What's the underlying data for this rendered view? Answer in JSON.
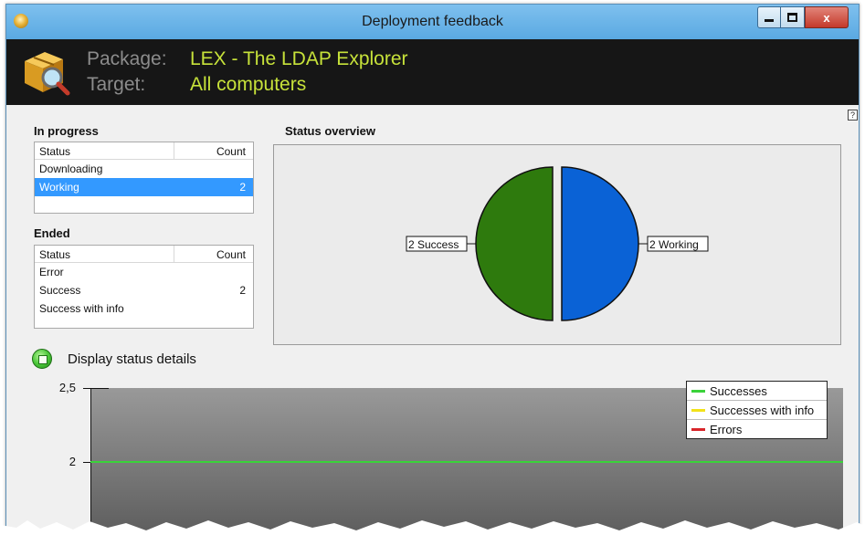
{
  "window": {
    "title": "Deployment feedback",
    "controls": {
      "minimize": "minimize",
      "maximize": "maximize",
      "close": "x"
    }
  },
  "header": {
    "package_label": "Package:",
    "package_value": "LEX - The LDAP Explorer",
    "target_label": "Target:",
    "target_value": "All computers"
  },
  "help_icon_label": "?",
  "in_progress": {
    "title": "In progress",
    "columns": [
      "Status",
      "Count"
    ],
    "rows": [
      {
        "status": "Downloading",
        "count": ""
      },
      {
        "status": "Working",
        "count": "2",
        "selected": true
      }
    ]
  },
  "ended": {
    "title": "Ended",
    "columns": [
      "Status",
      "Count"
    ],
    "rows": [
      {
        "status": "Error",
        "count": ""
      },
      {
        "status": "Success",
        "count": "2"
      },
      {
        "status": "Success with info",
        "count": ""
      }
    ]
  },
  "status_overview": {
    "title": "Status overview"
  },
  "status_details": {
    "label": "Display status details"
  },
  "chart_data": [
    {
      "type": "pie",
      "categories": [
        "Working",
        "Success"
      ],
      "values": [
        2,
        2
      ],
      "slice_labels": [
        "2 Working",
        "2 Success"
      ],
      "colors": [
        "#0a62d6",
        "#2e7a0d"
      ]
    },
    {
      "type": "line",
      "yticks": [
        "2,5",
        "2"
      ],
      "ytick_values": [
        2.5,
        2
      ],
      "ylim_top": 2.5,
      "series": [
        {
          "name": "Successes",
          "color": "#3ad23a",
          "value": 2
        },
        {
          "name": "Successes with info",
          "color": "#f2e21a"
        },
        {
          "name": "Errors",
          "color": "#d8252a"
        }
      ],
      "legend_position": "top-right"
    }
  ],
  "colors": {
    "title_bar": "#6fb7ea",
    "header_bg": "#161616",
    "header_value": "#c7e23a",
    "selection": "#3399ff"
  }
}
